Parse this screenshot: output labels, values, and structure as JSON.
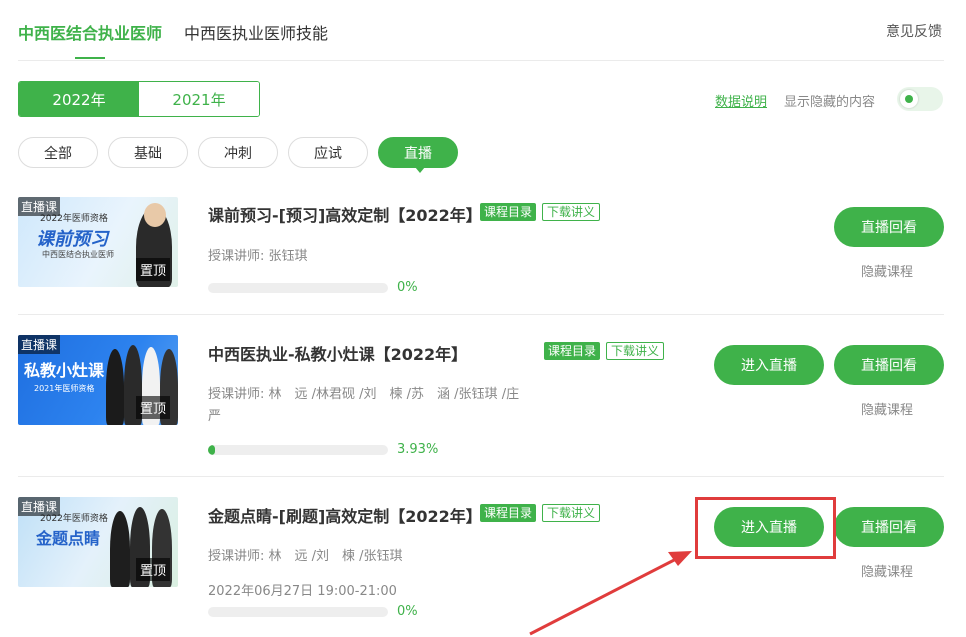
{
  "top_tabs": [
    {
      "label": "中西医结合执业医师",
      "active": true
    },
    {
      "label": "中西医执业医师技能",
      "active": false
    }
  ],
  "feedback_label": "意见反馈",
  "years": [
    {
      "label": "2022年",
      "active": true
    },
    {
      "label": "2021年",
      "active": false
    }
  ],
  "data_note_label": "数据说明",
  "show_hidden_label": "显示隐藏的内容",
  "show_hidden_on": true,
  "filters": [
    {
      "label": "全部",
      "active": false
    },
    {
      "label": "基础",
      "active": false
    },
    {
      "label": "冲刺",
      "active": false
    },
    {
      "label": "应试",
      "active": false
    },
    {
      "label": "直播",
      "active": true
    }
  ],
  "courses": [
    {
      "thumb_live_label": "直播课",
      "thumb_top_label": "置顶",
      "thumb_subtitle": "2022年医师资格",
      "thumb_title": "课前预习",
      "thumb_subtitle2": "中西医结合执业医师",
      "title": "课前预习-[预习]高效定制【2022年】",
      "tag_catalog": "课程目录",
      "tag_download": "下载讲义",
      "teacher": "授课讲师:   张钰琪",
      "progress": 0.0,
      "progress_text": "0%",
      "enter_live_label": "",
      "replay_label": "直播回看",
      "hide_label": "隐藏课程"
    },
    {
      "thumb_live_label": "直播课",
      "thumb_top_label": "置顶",
      "thumb_subtitle": "",
      "thumb_title": "私教小灶课",
      "thumb_subtitle2": "2021年医师资格",
      "title": "中西医执业-私教小灶课【2022年】",
      "tag_catalog": "课程目录",
      "tag_download": "下载讲义",
      "teacher": "授课讲师:   林　远 /林君砚 /刘　楝 /苏　涵 /张钰琪 /庄　严",
      "progress": 0.0393,
      "progress_text": "3.93%",
      "enter_live_label": "进入直播",
      "replay_label": "直播回看",
      "hide_label": "隐藏课程"
    },
    {
      "thumb_live_label": "直播课",
      "thumb_top_label": "置顶",
      "thumb_subtitle": "2022年医师资格",
      "thumb_title": "金题点睛",
      "thumb_subtitle2": "",
      "title": "金题点睛-[刷题]高效定制【2022年】",
      "tag_catalog": "课程目录",
      "tag_download": "下载讲义",
      "teacher": "授课讲师:   林　远 /刘　楝 /张钰琪",
      "time": "2022年06月27日 19:00-21:00",
      "progress": 0.0,
      "progress_text": "0%",
      "enter_live_label": "进入直播",
      "replay_label": "直播回看",
      "hide_label": "隐藏课程"
    }
  ],
  "colors": {
    "accent": "#3fb24a",
    "highlight": "#e03c3c"
  }
}
